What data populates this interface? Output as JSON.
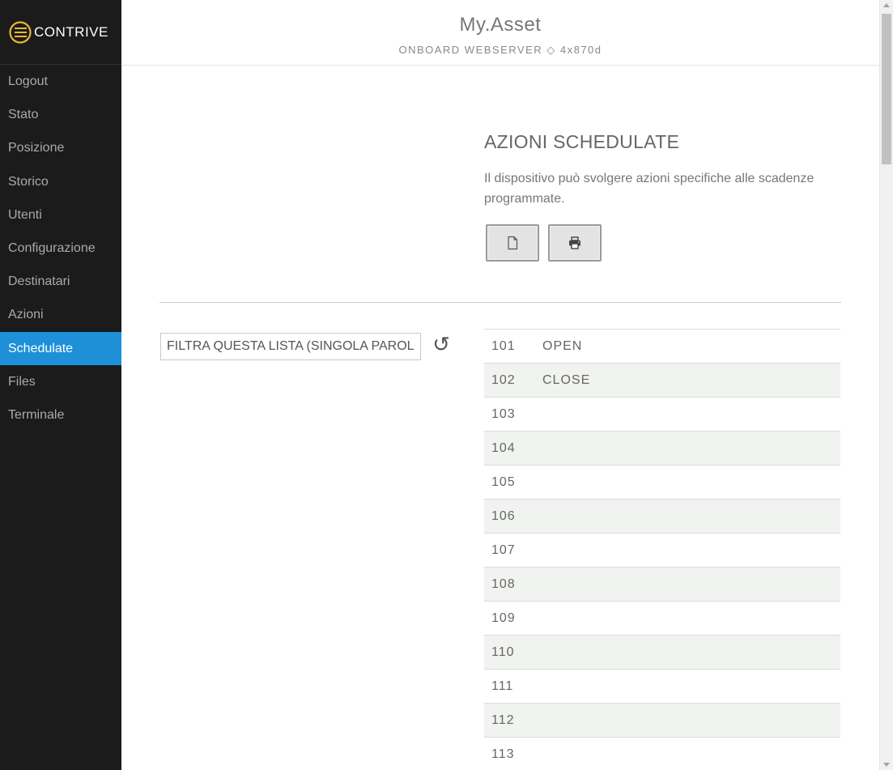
{
  "brand": {
    "name": "CONTRIVE",
    "accent": "#e8b931"
  },
  "colors": {
    "sidebar_bg": "#1b1b1b",
    "active_nav": "#1e90d8"
  },
  "sidebar": {
    "items": [
      {
        "label": "Logout",
        "active": false
      },
      {
        "label": "Stato",
        "active": false
      },
      {
        "label": "Posizione",
        "active": false
      },
      {
        "label": "Storico",
        "active": false
      },
      {
        "label": "Utenti",
        "active": false
      },
      {
        "label": "Configurazione",
        "active": false
      },
      {
        "label": "Destinatari",
        "active": false
      },
      {
        "label": "Azioni",
        "active": false
      },
      {
        "label": "Schedulate",
        "active": true
      },
      {
        "label": "Files",
        "active": false
      },
      {
        "label": "Terminale",
        "active": false
      }
    ]
  },
  "header": {
    "title": "My.Asset",
    "subtitle": "ONBOARD WEBSERVER ◇ 4x870d"
  },
  "section": {
    "title": "AZIONI SCHEDULATE",
    "description": "Il dispositivo può svolgere azioni specifiche alle scadenze programmate.",
    "new_icon": "file-icon",
    "print_icon": "print-icon"
  },
  "filter": {
    "placeholder": "FILTRA QUESTA LISTA (SINGOLA PAROLA)",
    "value": "",
    "reset_icon": "↺"
  },
  "schedules": [
    {
      "id": "101",
      "action": "OPEN"
    },
    {
      "id": "102",
      "action": "CLOSE"
    },
    {
      "id": "103",
      "action": ""
    },
    {
      "id": "104",
      "action": ""
    },
    {
      "id": "105",
      "action": ""
    },
    {
      "id": "106",
      "action": ""
    },
    {
      "id": "107",
      "action": ""
    },
    {
      "id": "108",
      "action": ""
    },
    {
      "id": "109",
      "action": ""
    },
    {
      "id": "110",
      "action": ""
    },
    {
      "id": "111",
      "action": ""
    },
    {
      "id": "112",
      "action": ""
    },
    {
      "id": "113",
      "action": ""
    }
  ]
}
